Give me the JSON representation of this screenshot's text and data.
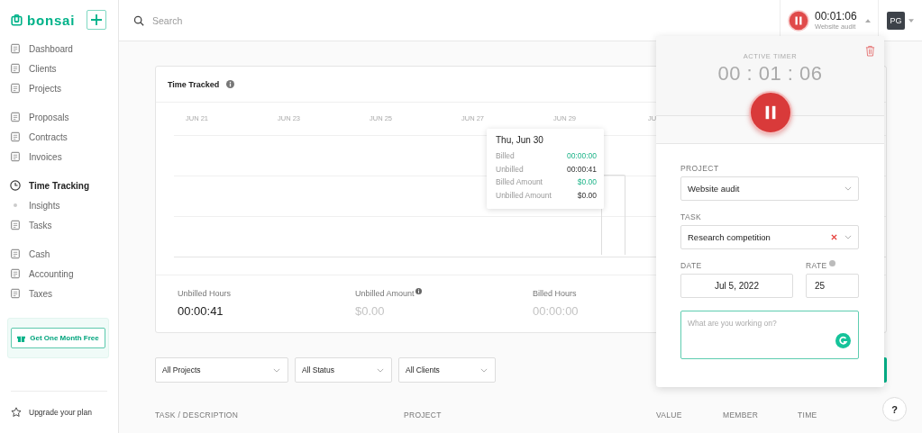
{
  "sidebar": {
    "logo": "bonsai",
    "groups": [
      [
        {
          "label": "Dashboard",
          "kind": "item",
          "selected": false
        },
        {
          "label": "Clients",
          "kind": "item",
          "selected": false
        },
        {
          "label": "Projects",
          "kind": "item",
          "selected": false
        }
      ],
      [
        {
          "label": "Proposals",
          "kind": "item",
          "selected": false
        },
        {
          "label": "Contracts",
          "kind": "item",
          "selected": false
        },
        {
          "label": "Invoices",
          "kind": "item",
          "selected": false
        }
      ],
      [
        {
          "label": "Time Tracking",
          "kind": "item",
          "selected": true
        },
        {
          "label": "Insights",
          "kind": "subitem",
          "selected": false
        },
        {
          "label": "Tasks",
          "kind": "item",
          "selected": false
        }
      ],
      [
        {
          "label": "Cash",
          "kind": "item",
          "selected": false
        },
        {
          "label": "Accounting",
          "kind": "item",
          "selected": false
        },
        {
          "label": "Taxes",
          "kind": "item",
          "selected": false
        }
      ]
    ],
    "promo": "Get One Month Free",
    "upgrade": "Upgrade your plan"
  },
  "topbar": {
    "search": {
      "placeholder": "Search"
    },
    "timer": {
      "time": "00:01:06",
      "project": "Website audit"
    },
    "avatar": "PG"
  },
  "card": {
    "title": "Time Tracked",
    "x_labels": [
      "JUN 21",
      "JUN 23",
      "JUN 25",
      "JUN 27",
      "JUN 29",
      "JU"
    ],
    "tooltip": {
      "title": "Thu, Jun 30",
      "rows": [
        {
          "label": "Billed",
          "value": "00:00:00",
          "kind": "billed"
        },
        {
          "label": "Unbilled",
          "value": "00:00:41",
          "kind": "unbilled"
        },
        {
          "label": "Billed Amount",
          "value": "$0.00",
          "kind": "billed"
        },
        {
          "label": "Unbilled Amount",
          "value": "$0.00",
          "kind": "unbilled"
        }
      ]
    },
    "stats": [
      {
        "label": "Unbilled Hours",
        "value": "00:00:41",
        "muted": false,
        "info": false
      },
      {
        "label": "Unbilled Amount",
        "value": "$0.00",
        "muted": true,
        "info": true
      },
      {
        "label": "Billed Hours",
        "value": "00:00:00",
        "muted": true,
        "info": false
      }
    ]
  },
  "filters": [
    "All Projects",
    "All Status",
    "All Clients"
  ],
  "table": {
    "columns": [
      "TASK / DESCRIPTION",
      "PROJECT",
      "VALUE",
      "MEMBER",
      "TIME"
    ]
  },
  "help": "?",
  "popup": {
    "label": "ACTIVE TIMER",
    "time": "00 : 01 : 06",
    "project_label": "PROJECT",
    "project": "Website audit",
    "task_label": "TASK",
    "task": "Research competition",
    "date_label": "DATE",
    "date": "Jul 5, 2022",
    "rate_label": "RATE",
    "rate": "25",
    "notes": {
      "placeholder": "What are you working on?"
    }
  }
}
